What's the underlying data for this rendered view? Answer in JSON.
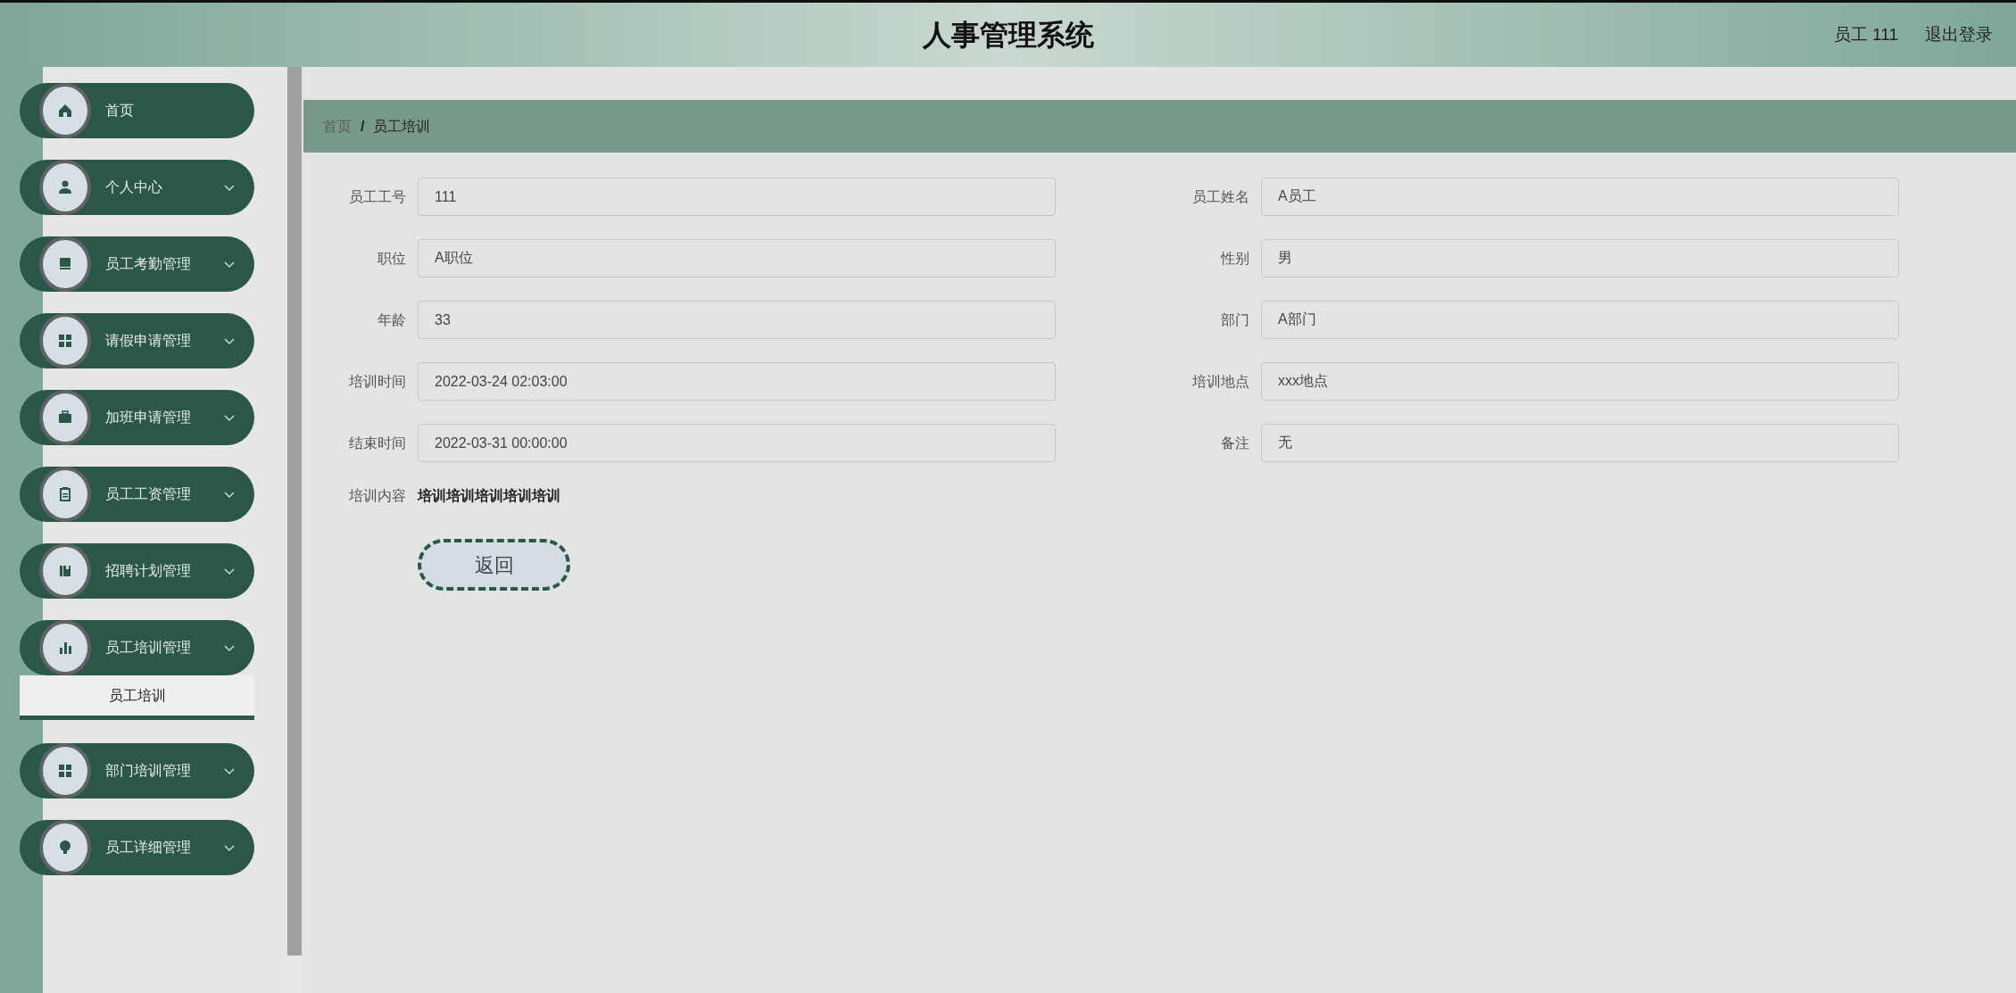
{
  "header": {
    "title": "人事管理系统",
    "user": "员工 111",
    "logout": "退出登录"
  },
  "sidebar": {
    "items": [
      {
        "label": "首页",
        "kind": "link"
      },
      {
        "label": "个人中心",
        "kind": "group"
      },
      {
        "label": "员工考勤管理",
        "kind": "group"
      },
      {
        "label": "请假申请管理",
        "kind": "group"
      },
      {
        "label": "加班申请管理",
        "kind": "group"
      },
      {
        "label": "员工工资管理",
        "kind": "group"
      },
      {
        "label": "招聘计划管理",
        "kind": "group"
      },
      {
        "label": "员工培训管理",
        "kind": "group",
        "children": [
          {
            "label": "员工培训"
          }
        ]
      },
      {
        "label": "部门培训管理",
        "kind": "group"
      },
      {
        "label": "员工详细管理",
        "kind": "group"
      }
    ]
  },
  "breadcrumb": {
    "separator": "/",
    "items": [
      "首页",
      "员工培训"
    ]
  },
  "form": {
    "fields": [
      {
        "label": "员工工号",
        "value": "111",
        "kind": "input"
      },
      {
        "label": "员工姓名",
        "value": "A员工",
        "kind": "input"
      },
      {
        "label": "职位",
        "value": "A职位",
        "kind": "input"
      },
      {
        "label": "性别",
        "value": "男",
        "kind": "input"
      },
      {
        "label": "年龄",
        "value": "33",
        "kind": "input"
      },
      {
        "label": "部门",
        "value": "A部门",
        "kind": "input"
      },
      {
        "label": "培训时间",
        "value": "2022-03-24 02:03:00",
        "kind": "input"
      },
      {
        "label": "培训地点",
        "value": "xxx地点",
        "kind": "input"
      },
      {
        "label": "结束时间",
        "value": "2022-03-31 00:00:00",
        "kind": "input"
      },
      {
        "label": "备注",
        "value": "无",
        "kind": "input"
      },
      {
        "label": "培训内容",
        "value": "培训培训培训培训培训",
        "kind": "text"
      }
    ],
    "buttons": [
      "返回"
    ]
  }
}
